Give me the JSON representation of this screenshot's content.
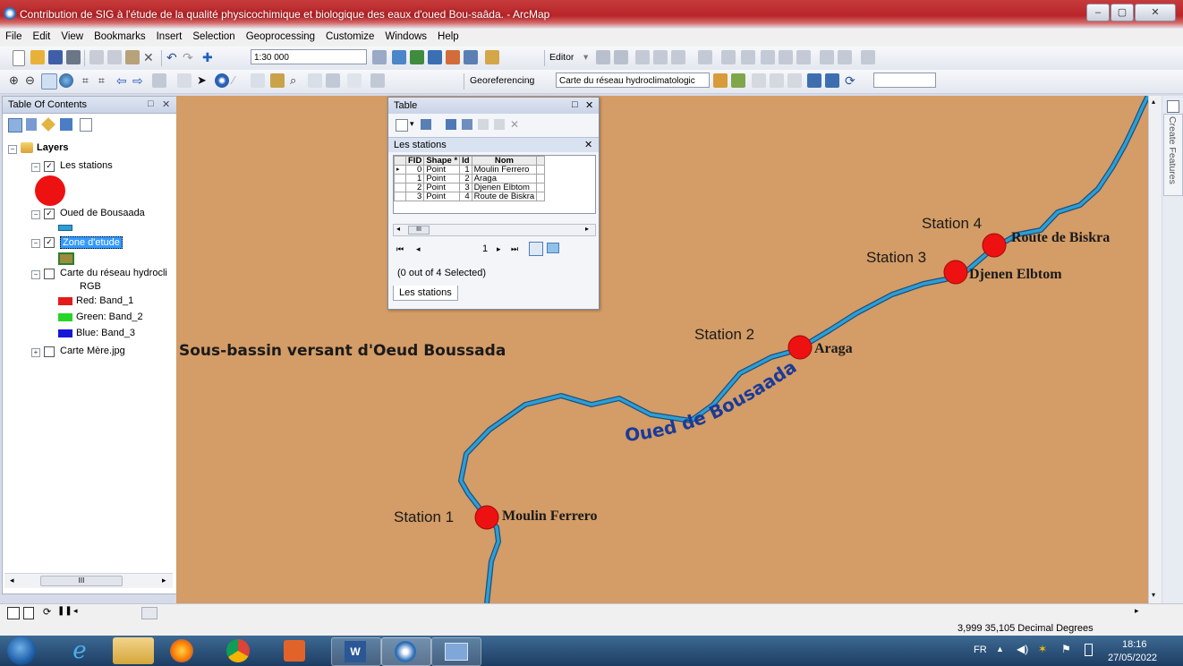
{
  "window": {
    "title": "Contribution de SIG à l'étude de la qualité physicochimique et biologique des eaux d'oued  Bou-saâda. - ArcMap"
  },
  "menu": [
    "File",
    "Edit",
    "View",
    "Bookmarks",
    "Insert",
    "Selection",
    "Geoprocessing",
    "Customize",
    "Windows",
    "Help"
  ],
  "toolbar1": {
    "scale": "1:30 000",
    "editor_label": "Editor"
  },
  "toolbar2": {
    "georeferencing_label": "Georeferencing",
    "layer_combo": "Carte du réseau hydroclimatologic"
  },
  "toc": {
    "title": "Table Of Contents",
    "root": "Layers",
    "layers": [
      {
        "name": "Les stations",
        "checked": true
      },
      {
        "name": "Oued de Bousaada",
        "checked": true
      },
      {
        "name": "Zone d'etude",
        "checked": true
      },
      {
        "name": "Carte du réseau hydrocli",
        "checked": false
      },
      {
        "name": "Carte Mère.jpg",
        "checked": false
      }
    ],
    "rgb_label": "RGB",
    "bands": [
      "Red:   Band_1",
      "Green: Band_2",
      "Blue:   Band_3"
    ]
  },
  "table_window": {
    "title": "Table",
    "tab_title": "Les stations",
    "columns": [
      "FID",
      "Shape *",
      "Id",
      "Nom"
    ],
    "rows": [
      [
        "0",
        "Point",
        "1",
        "Moulin Ferrero"
      ],
      [
        "1",
        "Point",
        "2",
        "Araga"
      ],
      [
        "2",
        "Point",
        "3",
        "Djenen Elbtom"
      ],
      [
        "3",
        "Point",
        "4",
        "Route de Biskra"
      ]
    ],
    "record": "1",
    "selection_text": "(0 out of 4 Selected)",
    "bottom_tab": "Les stations"
  },
  "map": {
    "basin_label": "Sous-bassin versant d'Oeud Boussada",
    "river_label": "Oued de Bousaada",
    "stations": [
      {
        "station_label": "Station 1",
        "name": "Moulin Ferrero"
      },
      {
        "station_label": "Station 2",
        "name": "Araga"
      },
      {
        "station_label": "Station 3",
        "name": "Djenen Elbtom"
      },
      {
        "station_label": "Station 4",
        "name": "Route de Biskra"
      }
    ]
  },
  "side_panel": {
    "create_features": "Create Features"
  },
  "status": {
    "coordinates": "3,999  35,105 Decimal Degrees"
  },
  "taskbar": {
    "lang": "FR",
    "time": "18:16",
    "date": "27/05/2022"
  },
  "colors": {
    "map_bg": "#d49c66",
    "river": "#2d9fd2",
    "station": "#ee1111",
    "label_blue": "#1a3b98"
  }
}
